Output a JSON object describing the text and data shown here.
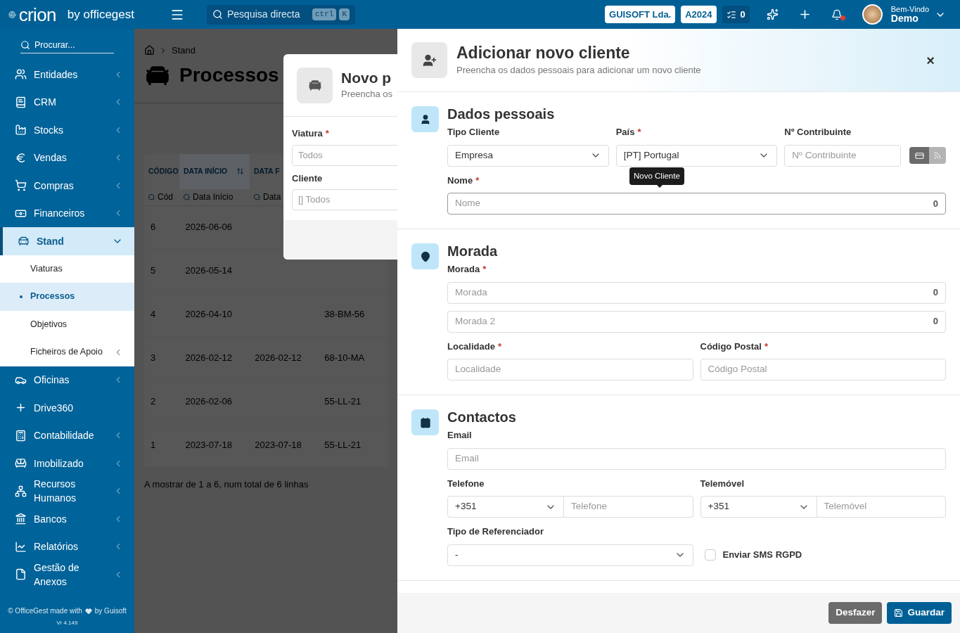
{
  "topbar": {
    "logo": "crion",
    "logo_suffix": "by officegest",
    "search": {
      "placeholder": "Pesquisa directa",
      "shortcut": [
        "ctrl",
        "K"
      ]
    },
    "company": "GUISOFT Lda.",
    "year": "A2024",
    "tasks_count": "0",
    "notifications_unread": true,
    "user": {
      "greeting": "Bem-Vindo",
      "name": "Demo"
    }
  },
  "sidebar": {
    "search": {
      "placeholder": "Procurar..."
    },
    "items": [
      {
        "label": "Entidades",
        "expanded": false,
        "selected": false
      },
      {
        "label": "CRM",
        "expanded": false,
        "selected": false
      },
      {
        "label": "Stocks",
        "expanded": false,
        "selected": false
      },
      {
        "label": "Vendas",
        "expanded": false,
        "selected": false
      },
      {
        "label": "Compras",
        "expanded": false,
        "selected": false
      },
      {
        "label": "Financeiros",
        "expanded": false,
        "selected": false
      },
      {
        "label": "Stand",
        "expanded": true,
        "selected": true,
        "children": [
          {
            "label": "Viaturas",
            "selected": false
          },
          {
            "label": "Processos",
            "selected": true
          },
          {
            "label": "Objetivos",
            "selected": false
          },
          {
            "label": "Ficheiros de Apoio",
            "selected": false,
            "expanded": false
          }
        ]
      },
      {
        "label": "Oficinas",
        "expanded": false,
        "selected": false
      },
      {
        "label": "Drive360",
        "selected": false
      },
      {
        "label": "Contabilidade",
        "expanded": false,
        "selected": false
      },
      {
        "label": "Imobilizado",
        "expanded": false,
        "selected": false
      },
      {
        "label": "Recursos Humanos",
        "expanded": false,
        "selected": false
      },
      {
        "label": "Bancos",
        "expanded": false,
        "selected": false
      },
      {
        "label": "Relatórios",
        "expanded": false,
        "selected": false
      },
      {
        "label": "Gestão de Anexos",
        "expanded": false,
        "selected": false
      }
    ],
    "footer": {
      "made_with": "© OfficeGest made with",
      "by": "by Guisoft",
      "version": "Vr 4.149"
    }
  },
  "page": {
    "breadcrumb": [
      "Stand"
    ],
    "title": "Processos",
    "table": {
      "columns": [
        {
          "label": "CÓDIGO",
          "filter_placeholder": "Cód"
        },
        {
          "label": "DATA INÍCIO",
          "sorted": true,
          "filter_placeholder": "Data Início"
        },
        {
          "label": "DATA F",
          "filter_placeholder": "Data"
        }
      ],
      "rows": [
        [
          "6",
          "2026-06-06",
          "",
          ""
        ],
        [
          "5",
          "2026-05-14",
          "",
          ""
        ],
        [
          "4",
          "2026-04-10",
          "",
          "38-BM-56"
        ],
        [
          "3",
          "2026-02-12",
          "2026-02-12",
          "68-10-MA"
        ],
        [
          "2",
          "2026-02-06",
          "",
          "55-LL-21"
        ],
        [
          "1",
          "2023-07-18",
          "2023-07-18",
          "55-LL-21"
        ]
      ]
    },
    "summary": "A mostrar de 1 a 6, num total de 6 linhas"
  },
  "modal": {
    "title": "Novo p",
    "subtitle": "Preencha os",
    "fields": [
      {
        "label": "Viatura",
        "required_mark": "*",
        "placeholder": "Todos"
      },
      {
        "label": "Cliente",
        "placeholder": "[] Todos"
      }
    ]
  },
  "drawer": {
    "title": "Adicionar novo cliente",
    "subtitle": "Preencha os dados pessoais para adicionar um novo cliente",
    "close": "×",
    "sections": [
      {
        "title": "Dados pessoais",
        "rows": [
          [
            {
              "kind": "select",
              "label": "Tipo Cliente",
              "value": "Empresa"
            },
            {
              "kind": "select",
              "label": "País",
              "required_mark": "*",
              "value": "[PT] Portugal"
            },
            {
              "kind": "vat",
              "label": "Nº Contribuinte",
              "placeholder": "Nº Contribuinte"
            }
          ],
          [
            {
              "kind": "input",
              "label": "Nome",
              "required_mark": "*",
              "placeholder": "Nome",
              "counter": "0",
              "tooltip": "Novo Cliente"
            }
          ]
        ]
      },
      {
        "title": "Morada",
        "rows": [
          [
            {
              "kind": "input",
              "label": "Morada",
              "required_mark": "*",
              "placeholder": "Morada",
              "counter": "0"
            }
          ],
          [
            {
              "kind": "input",
              "placeholder": "Morada 2",
              "counter": "0"
            }
          ],
          [
            {
              "kind": "input",
              "label": "Localidade",
              "required_mark": "*",
              "placeholder": "Localidade"
            },
            {
              "kind": "input",
              "label": "Código Postal",
              "required_mark": "*",
              "placeholder": "Código Postal"
            }
          ]
        ]
      },
      {
        "title": "Contactos",
        "rows": [
          [
            {
              "kind": "input",
              "label": "Email",
              "placeholder": "Email"
            }
          ],
          [
            {
              "kind": "phone",
              "label": "Telefone",
              "prefix": "+351",
              "placeholder": "Telefone"
            },
            {
              "kind": "phone",
              "label": "Telemóvel",
              "prefix": "+351",
              "placeholder": "Telemóvel"
            }
          ],
          [
            {
              "kind": "select",
              "label": "Tipo de Referenciador",
              "value": "-"
            },
            {
              "kind": "checkbox",
              "label": "Enviar SMS RGPD",
              "checked": false
            }
          ]
        ]
      }
    ],
    "buttons": [
      {
        "label": "Desfazer",
        "kind": "secondary"
      },
      {
        "label": "Guardar",
        "kind": "primary"
      }
    ]
  }
}
